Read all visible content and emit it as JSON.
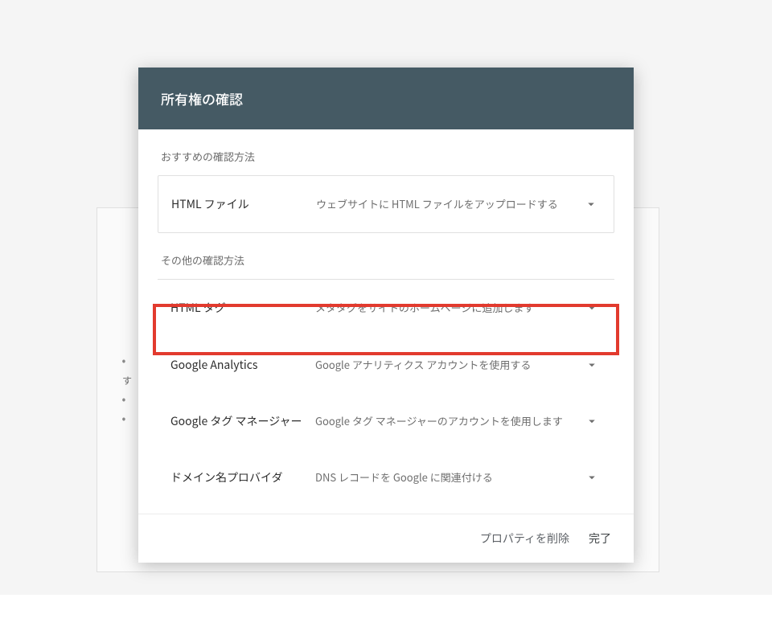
{
  "dialog": {
    "title": "所有権の確認",
    "recommended_label": "おすすめの確認方法",
    "other_label": "その他の確認方法",
    "recommended": {
      "title": "HTML ファイル",
      "desc": "ウェブサイトに HTML ファイルをアップロードする"
    },
    "other_methods": [
      {
        "title": "HTML タグ",
        "desc": "メタタグをサイトのホームページに追加します"
      },
      {
        "title": "Google Analytics",
        "desc": "Google アナリティクス アカウントを使用する"
      },
      {
        "title": "Google タグ マネージャー",
        "desc": "Google タグ マネージャーのアカウントを使用します"
      },
      {
        "title": "ドメイン名プロバイダ",
        "desc": "DNS レコードを Google に関連付ける"
      }
    ],
    "footer": {
      "delete": "プロパティを削除",
      "done": "完了"
    }
  },
  "background": {
    "partial_text": "す"
  },
  "highlight_index": 0,
  "colors": {
    "header_bg": "#455a64",
    "highlight_border": "#e23a2e"
  }
}
